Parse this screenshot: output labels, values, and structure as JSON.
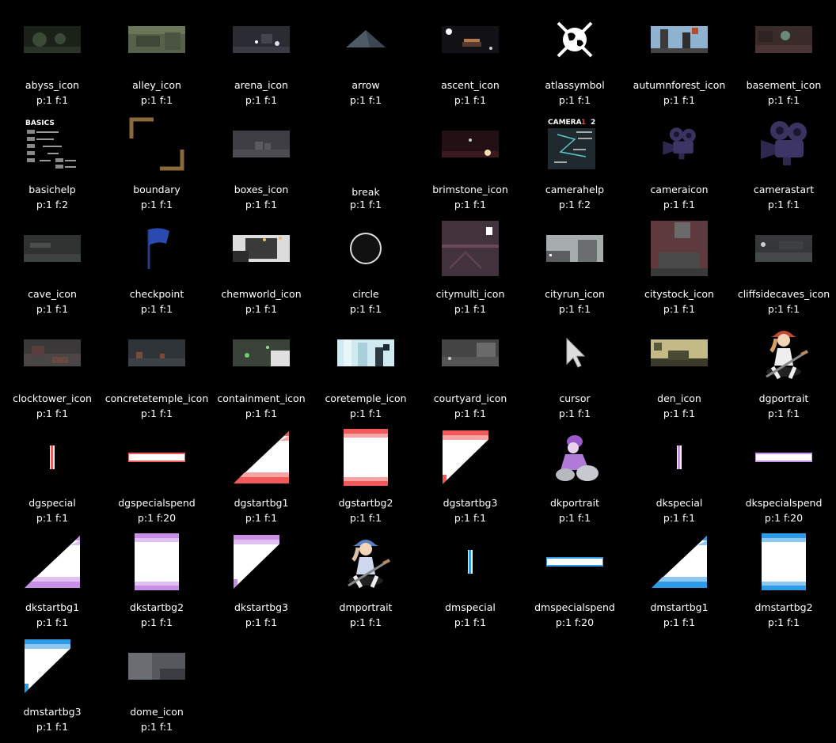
{
  "assets": [
    {
      "name": "abyss_icon",
      "meta": "p:1 f:1",
      "icon": "abyss-icon"
    },
    {
      "name": "alley_icon",
      "meta": "p:1 f:1",
      "icon": "alley-icon"
    },
    {
      "name": "arena_icon",
      "meta": "p:1 f:1",
      "icon": "arena-icon"
    },
    {
      "name": "arrow",
      "meta": "p:1 f:1",
      "icon": "arrow-icon"
    },
    {
      "name": "ascent_icon",
      "meta": "p:1 f:1",
      "icon": "ascent-icon"
    },
    {
      "name": "atlassymbol",
      "meta": "p:1 f:1",
      "icon": "atlas-symbol-icon"
    },
    {
      "name": "autumnforest_icon",
      "meta": "p:1 f:1",
      "icon": "autumnforest-icon"
    },
    {
      "name": "basement_icon",
      "meta": "p:1 f:1",
      "icon": "basement-icon"
    },
    {
      "name": "basichelp",
      "meta": "p:1 f:2",
      "icon": "basic-help-icon",
      "help_title": "BASICS"
    },
    {
      "name": "boundary",
      "meta": "p:1 f:1",
      "icon": "boundary-icon"
    },
    {
      "name": "boxes_icon",
      "meta": "p:1 f:1",
      "icon": "boxes-icon"
    },
    {
      "name": "break",
      "meta": "p:1 f:1",
      "icon": "break-icon"
    },
    {
      "name": "brimstone_icon",
      "meta": "p:1 f:1",
      "icon": "brimstone-icon"
    },
    {
      "name": "camerahelp",
      "meta": "p:1 f:2",
      "icon": "camera-help-icon",
      "help_title": "CAMERA",
      "help_num1": "1",
      "help_num2": "2"
    },
    {
      "name": "cameraicon",
      "meta": "p:1 f:1",
      "icon": "camera-icon"
    },
    {
      "name": "camerastart",
      "meta": "p:1 f:1",
      "icon": "camera-start-icon"
    },
    {
      "name": "cave_icon",
      "meta": "p:1 f:1",
      "icon": "cave-icon"
    },
    {
      "name": "checkpoint",
      "meta": "p:1 f:1",
      "icon": "checkpoint-flag-icon"
    },
    {
      "name": "chemworld_icon",
      "meta": "p:1 f:1",
      "icon": "chemworld-icon"
    },
    {
      "name": "circle",
      "meta": "p:1 f:1",
      "icon": "circle-icon"
    },
    {
      "name": "citymulti_icon",
      "meta": "p:1 f:1",
      "icon": "citymulti-icon"
    },
    {
      "name": "cityrun_icon",
      "meta": "p:1 f:1",
      "icon": "cityrun-icon"
    },
    {
      "name": "citystock_icon",
      "meta": "p:1 f:1",
      "icon": "citystock-icon"
    },
    {
      "name": "cliffsidecaves_icon",
      "meta": "p:1 f:1",
      "icon": "cliffsidecaves-icon"
    },
    {
      "name": "clocktower_icon",
      "meta": "p:1 f:1",
      "icon": "clocktower-icon"
    },
    {
      "name": "concretetemple_icon",
      "meta": "p:1 f:1",
      "icon": "concretetemple-icon"
    },
    {
      "name": "containment_icon",
      "meta": "p:1 f:1",
      "icon": "containment-icon"
    },
    {
      "name": "coretemple_icon",
      "meta": "p:1 f:1",
      "icon": "coretemple-icon"
    },
    {
      "name": "courtyard_icon",
      "meta": "p:1 f:1",
      "icon": "courtyard-icon"
    },
    {
      "name": "cursor",
      "meta": "p:1 f:1",
      "icon": "cursor-icon"
    },
    {
      "name": "den_icon",
      "meta": "p:1 f:1",
      "icon": "den-icon"
    },
    {
      "name": "dgportrait",
      "meta": "p:1 f:1",
      "icon": "dg-portrait-icon"
    },
    {
      "name": "dgspecial",
      "meta": "p:1 f:1",
      "icon": "dg-special-icon"
    },
    {
      "name": "dgspecialspend",
      "meta": "p:1 f:20",
      "icon": "dg-special-spend-icon"
    },
    {
      "name": "dgstartbg1",
      "meta": "p:1 f:1",
      "icon": "dg-startbg1-icon"
    },
    {
      "name": "dgstartbg2",
      "meta": "p:1 f:1",
      "icon": "dg-startbg2-icon"
    },
    {
      "name": "dgstartbg3",
      "meta": "p:1 f:1",
      "icon": "dg-startbg3-icon"
    },
    {
      "name": "dkportrait",
      "meta": "p:1 f:1",
      "icon": "dk-portrait-icon"
    },
    {
      "name": "dkspecial",
      "meta": "p:1 f:1",
      "icon": "dk-special-icon"
    },
    {
      "name": "dkspecialspend",
      "meta": "p:1 f:20",
      "icon": "dk-special-spend-icon"
    },
    {
      "name": "dkstartbg1",
      "meta": "p:1 f:1",
      "icon": "dk-startbg1-icon"
    },
    {
      "name": "dkstartbg2",
      "meta": "p:1 f:1",
      "icon": "dk-startbg2-icon"
    },
    {
      "name": "dkstartbg3",
      "meta": "p:1 f:1",
      "icon": "dk-startbg3-icon"
    },
    {
      "name": "dmportrait",
      "meta": "p:1 f:1",
      "icon": "dm-portrait-icon"
    },
    {
      "name": "dmspecial",
      "meta": "p:1 f:1",
      "icon": "dm-special-icon"
    },
    {
      "name": "dmspecialspend",
      "meta": "p:1 f:20",
      "icon": "dm-special-spend-icon"
    },
    {
      "name": "dmstartbg1",
      "meta": "p:1 f:1",
      "icon": "dm-startbg1-icon"
    },
    {
      "name": "dmstartbg2",
      "meta": "p:1 f:1",
      "icon": "dm-startbg2-icon"
    },
    {
      "name": "dmstartbg3",
      "meta": "p:1 f:1",
      "icon": "dm-startbg3-icon"
    },
    {
      "name": "dome_icon",
      "meta": "p:1 f:1",
      "icon": "dome-icon"
    }
  ],
  "colors": {
    "background": "#000000",
    "text": "#ffffff",
    "dg_accent": "#f25a5a",
    "dk_accent": "#c98ee6",
    "dm_accent": "#2f9be6"
  }
}
